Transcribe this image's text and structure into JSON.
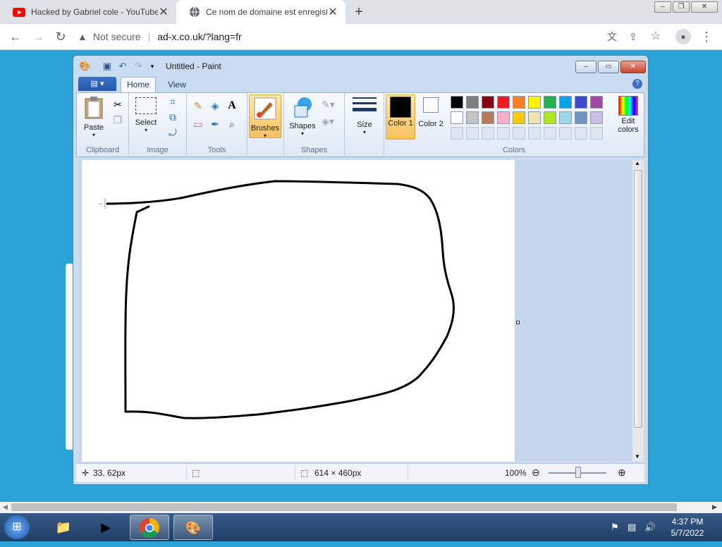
{
  "browser": {
    "tabs": [
      {
        "title": "Hacked by Gabriel cole - YouTube",
        "icon": "youtube-icon"
      },
      {
        "title": "Ce nom de domaine est enregistré",
        "icon": "globe-icon",
        "active": true
      }
    ],
    "new_tab_label": "+",
    "security_label": "Not secure",
    "url": "ad-x.co.uk/?lang=fr"
  },
  "paint": {
    "title": "Untitled - Paint",
    "ribbon_tabs": [
      "Home",
      "View"
    ],
    "groups": {
      "clipboard": {
        "label": "Clipboard",
        "paste": "Paste"
      },
      "image": {
        "label": "Image",
        "select": "Select"
      },
      "tools": {
        "label": "Tools"
      },
      "brushes": {
        "label": "Brushes"
      },
      "shapes": {
        "label": "Shapes",
        "shapes_btn": "Shapes"
      },
      "size": {
        "label": "Size"
      },
      "colors": {
        "label": "Colors",
        "color1": "Color 1",
        "color2": "Color 2",
        "edit": "Edit colors"
      }
    },
    "color1": "#000000",
    "color2": "#ffffff",
    "palette": [
      "#000000",
      "#7f7f7f",
      "#880015",
      "#ed1c24",
      "#ff7f27",
      "#fff200",
      "#22b14c",
      "#00a2e8",
      "#3f48cc",
      "#a349a4",
      "#ffffff",
      "#c3c3c3",
      "#b97a57",
      "#ffaec9",
      "#ffc90e",
      "#efe4b0",
      "#b5e61d",
      "#99d9ea",
      "#7092be",
      "#c8bfe7"
    ],
    "status": {
      "cursor_pos": "33, 62px",
      "canvas_size": "614 × 460px",
      "zoom": "100%"
    }
  },
  "taskbar": {
    "time": "4:37 PM",
    "date": "5/7/2022"
  }
}
